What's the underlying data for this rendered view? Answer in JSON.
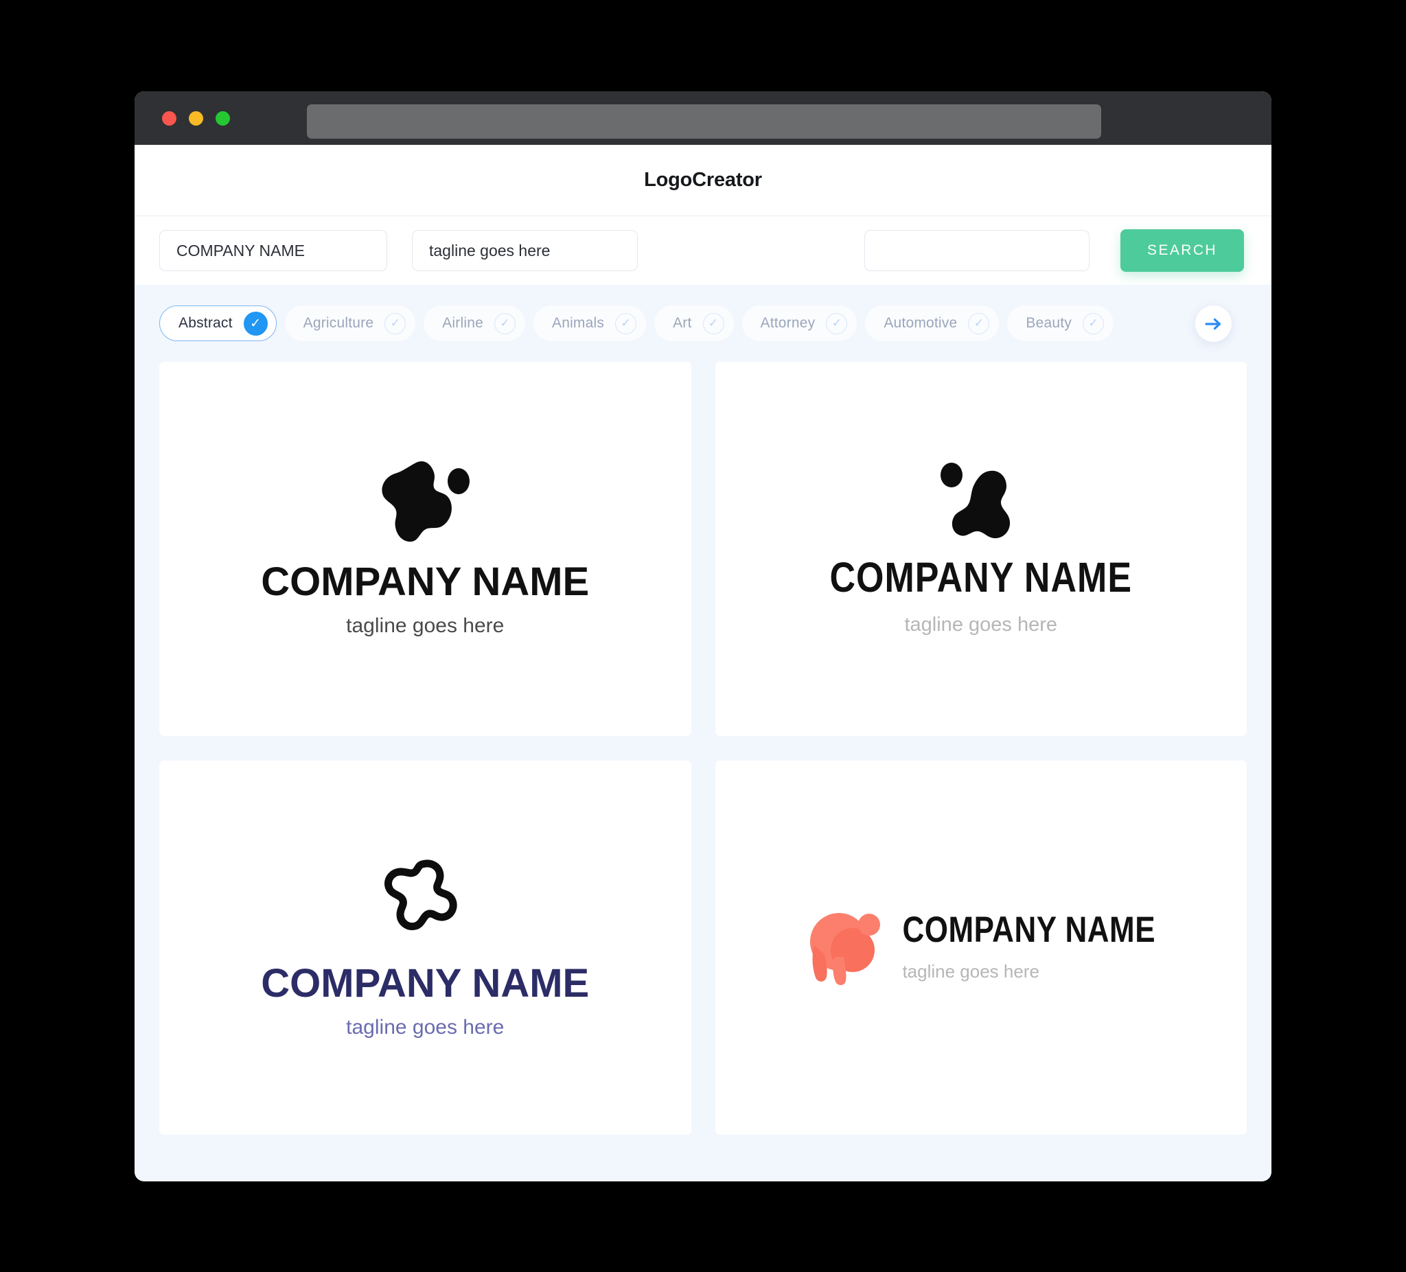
{
  "window": {
    "traffic_lights": [
      "close",
      "minimize",
      "maximize"
    ],
    "url_bar_value": ""
  },
  "header": {
    "title": "LogoCreator"
  },
  "search": {
    "company_value": "COMPANY NAME",
    "company_placeholder": "COMPANY NAME",
    "tagline_value": "tagline goes here",
    "tagline_placeholder": "tagline goes here",
    "extra_value": "",
    "extra_placeholder": "",
    "search_label": "SEARCH",
    "search_color": "#4ecb9b"
  },
  "categories": {
    "selected": "Abstract",
    "accent_color": "#2196f3",
    "next_label": "next",
    "items": [
      {
        "label": "Abstract",
        "selected": true
      },
      {
        "label": "Agriculture",
        "selected": false
      },
      {
        "label": "Airline",
        "selected": false
      },
      {
        "label": "Animals",
        "selected": false
      },
      {
        "label": "Art",
        "selected": false
      },
      {
        "label": "Attorney",
        "selected": false
      },
      {
        "label": "Automotive",
        "selected": false
      },
      {
        "label": "Beauty",
        "selected": false
      }
    ]
  },
  "logos": [
    {
      "name": "COMPANY NAME",
      "tagline": "tagline goes here",
      "mark": "filled-blob-with-dot",
      "mark_color": "#0d0d0d",
      "text_color": "#111111",
      "tagline_color": "#4a4a4a",
      "layout": "stacked"
    },
    {
      "name": "COMPANY NAME",
      "tagline": "tagline goes here",
      "mark": "blob-with-separate-dot",
      "mark_color": "#0d0d0d",
      "text_color": "#111111",
      "tagline_color": "#b6b6b6",
      "layout": "stacked"
    },
    {
      "name": "COMPANY NAME",
      "tagline": "tagline goes here",
      "mark": "outline-blob",
      "mark_color": "#0d0d0d",
      "text_color": "#2c2c66",
      "tagline_color": "#6b6bb0",
      "layout": "stacked"
    },
    {
      "name": "COMPANY NAME",
      "tagline": "tagline goes here",
      "mark": "coral-drip-blob",
      "mark_color": "#fb7f6c",
      "text_color": "#111111",
      "tagline_color": "#b6b6b6",
      "layout": "inline"
    }
  ]
}
